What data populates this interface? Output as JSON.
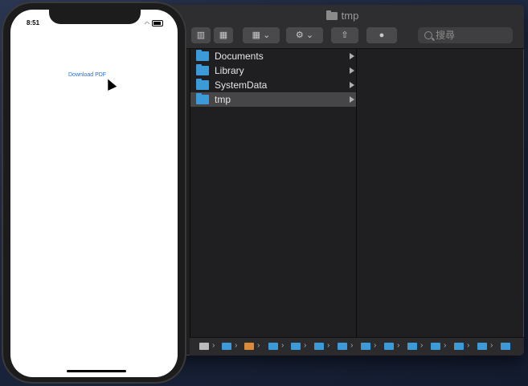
{
  "finder": {
    "title": "tmp",
    "search_placeholder": "搜尋",
    "items": [
      {
        "label": "Documents",
        "selected": false
      },
      {
        "label": "Library",
        "selected": false
      },
      {
        "label": "SystemData",
        "selected": false
      },
      {
        "label": "tmp",
        "selected": true
      }
    ]
  },
  "phone": {
    "time": "8:51",
    "link_text": "Download PDF"
  },
  "colors": {
    "folder": "#3d9ad8",
    "link": "#1a6fe0",
    "selection": "#464648"
  }
}
